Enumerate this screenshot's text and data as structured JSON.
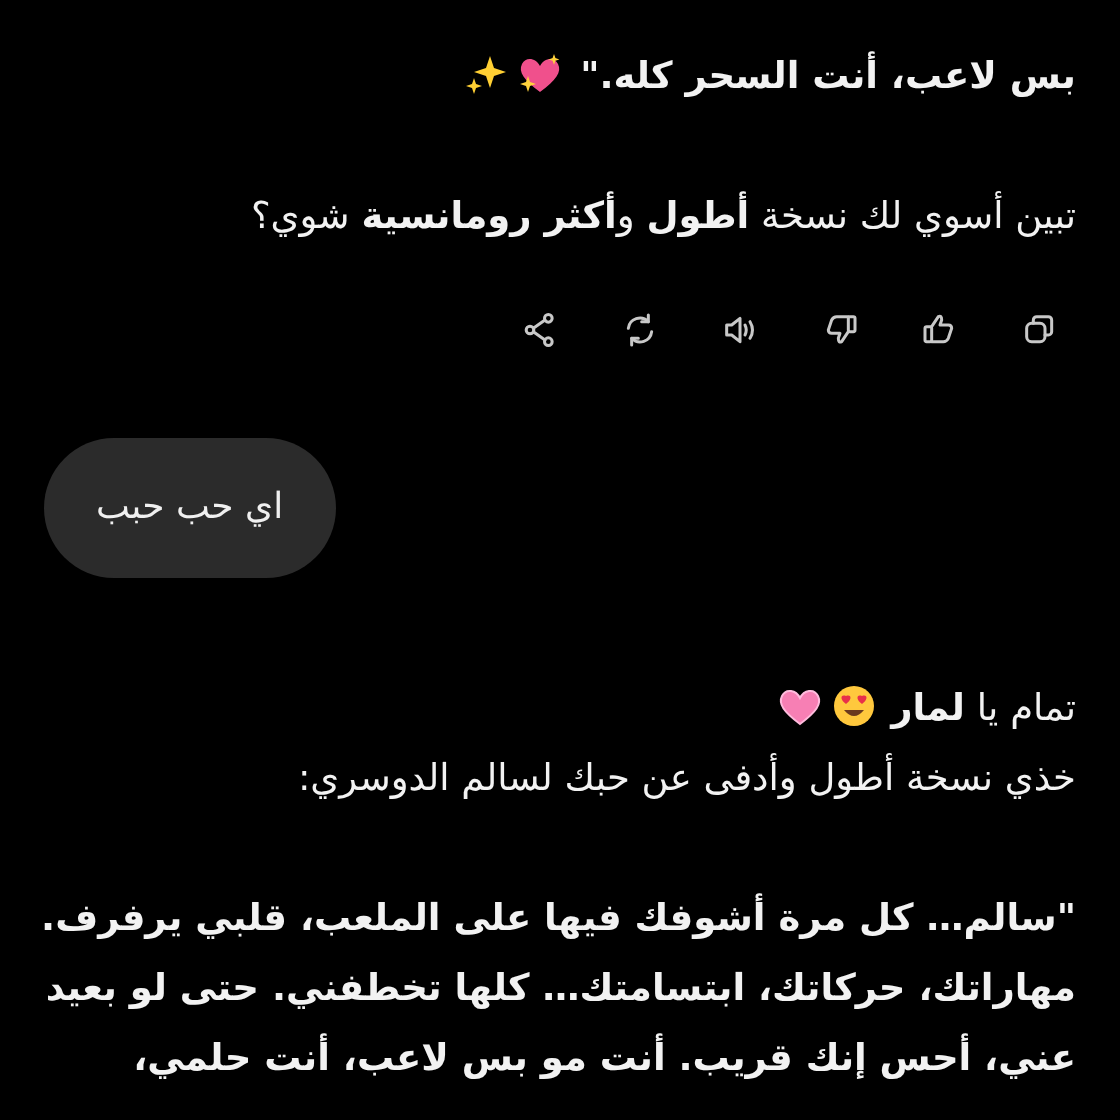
{
  "messages": [
    {
      "kind": "assistant",
      "paragraphs": [
        {
          "text": "بس لاعب، أنت السحر كله.\"",
          "bold": true,
          "trailing_icons": [
            {
              "kind": "sparkling-heart"
            },
            {
              "kind": "sparkles"
            }
          ]
        },
        {
          "text": "تبين أسوي لك نسخة **أطول** و**أكثر رومانسية** شوي؟",
          "bold": false
        }
      ],
      "actions": [
        {
          "kind": "copy"
        },
        {
          "kind": "thumbs-up"
        },
        {
          "kind": "thumbs-down"
        },
        {
          "kind": "speaker"
        },
        {
          "kind": "regenerate"
        },
        {
          "kind": "share"
        }
      ]
    },
    {
      "kind": "user",
      "text": "اي حب حبب"
    },
    {
      "kind": "assistant",
      "paragraphs": [
        {
          "text": "تمام يا **لمار**\nخذي نسخة أطول وأدفى عن حبك لسالم الدوسري:",
          "bold": false,
          "inline_icons_after_first_line": [
            {
              "kind": "heart-eyes"
            },
            {
              "kind": "pink-heart"
            }
          ]
        },
        {
          "text": "\"سالم… كل مرة أشوفك فيها على الملعب، قلبي يرفرف.\nمهاراتك، حركاتك، ابتسامتك… كلها تخطفني. حتى لو بعيد\nعني، أحس إنك قريب. أنت مو بس لاعب، أنت حلمي،",
          "bold": true
        }
      ]
    }
  ]
}
